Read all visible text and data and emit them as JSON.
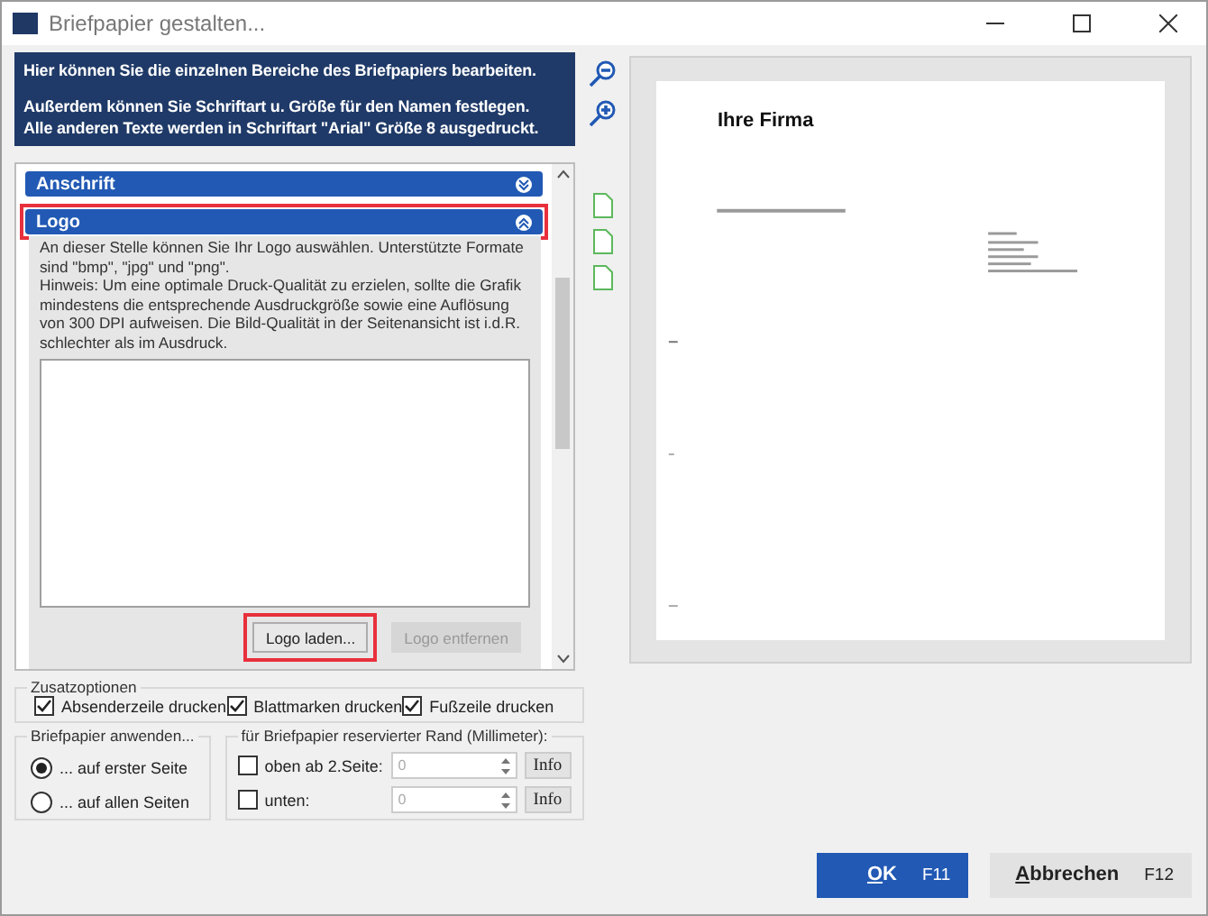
{
  "window": {
    "title": "Briefpapier gestalten..."
  },
  "intro": {
    "paragraphs": [
      [
        "Hier können Sie die einzelnen Bereiche des Briefpapiers bearbeiten."
      ],
      [
        "Außerdem können Sie Schriftart u. Größe für den Namen festlegen.",
        "Alle anderen Texte werden in Schriftart \"Arial\" Größe 8 ausgedruckt."
      ]
    ]
  },
  "sections": [
    {
      "title": "Anschrift",
      "expanded": false,
      "highlighted": false
    },
    {
      "title": "Logo",
      "expanded": true,
      "highlighted": true,
      "description": [
        "An dieser Stelle können Sie Ihr Logo auswählen. Unterstützte Formate sind \"bmp\", \"jpg\" und \"png\".",
        "Hinweis: Um eine optimale Druck-Qualität zu erzielen, sollte die Grafik mindestens die entsprechende Ausdruckgröße sowie eine Auflösung von 300 DPI aufweisen. Die Bild-Qualität in der Seitenansicht ist i.d.R. schlechter als im Ausdruck."
      ],
      "buttons": [
        {
          "label": "Logo laden...",
          "disabled": false,
          "highlighted": true
        },
        {
          "label": "Logo entfernen",
          "disabled": true,
          "highlighted": false
        }
      ]
    }
  ],
  "options": {
    "title": "Zusatzoptionen",
    "checkboxes": [
      {
        "label": "Absenderzeile drucken",
        "checked": true
      },
      {
        "label": "Blattmarken drucken",
        "checked": true
      },
      {
        "label": "Fußzeile drucken",
        "checked": true
      }
    ]
  },
  "apply": {
    "title": "Briefpapier anwenden...",
    "radios": [
      {
        "label": "... auf erster Seite",
        "selected": true
      },
      {
        "label": "... auf allen Seiten",
        "selected": false
      }
    ]
  },
  "margin": {
    "title": "für Briefpapier reservierter Rand (Millimeter):",
    "rows": [
      {
        "label": "oben ab 2.Seite:",
        "checked": false,
        "value": "0",
        "button": "Info"
      },
      {
        "label": "unten:",
        "checked": false,
        "value": "0",
        "button": "Info"
      }
    ]
  },
  "preview": {
    "company": "Ihre Firma"
  },
  "buttons": [
    {
      "label": "OK",
      "shortcut": "F11",
      "primary": true
    },
    {
      "label": "Abbrechen",
      "shortcut": "F12",
      "primary": false
    }
  ]
}
